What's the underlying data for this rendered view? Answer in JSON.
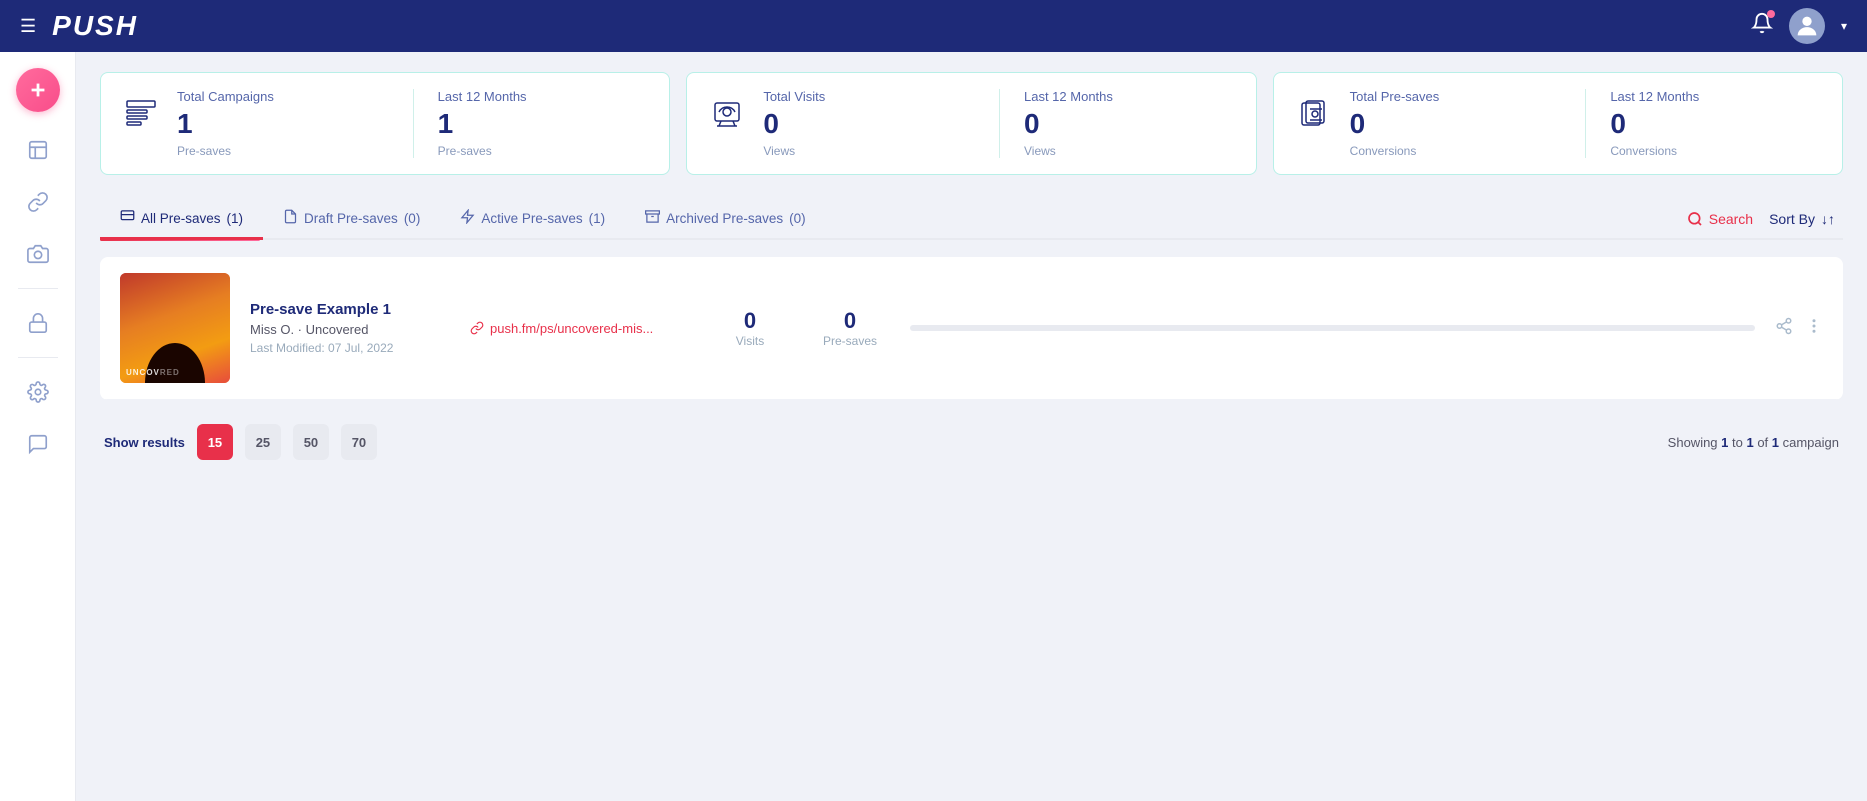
{
  "header": {
    "logo": "PUSH",
    "notification_label": "notifications",
    "chevron_label": "▾"
  },
  "sidebar": {
    "add_label": "+",
    "items": [
      {
        "id": "campaigns",
        "icon": "campaigns-icon"
      },
      {
        "id": "link",
        "icon": "link-icon"
      },
      {
        "id": "camera",
        "icon": "camera-icon"
      },
      {
        "id": "lock",
        "icon": "lock-icon"
      },
      {
        "id": "settings",
        "icon": "settings-icon"
      },
      {
        "id": "chat",
        "icon": "chat-icon"
      }
    ]
  },
  "stats": [
    {
      "id": "campaigns-stat",
      "title": "Total Campaigns",
      "value": "1",
      "sub": "Pre-saves",
      "last12_value": "1",
      "last12_sub": "Pre-saves",
      "last12_title": "Last 12 Months"
    },
    {
      "id": "visits-stat",
      "title": "Total Visits",
      "value": "0",
      "sub": "Views",
      "last12_value": "0",
      "last12_sub": "Views",
      "last12_title": "Last 12 Months"
    },
    {
      "id": "presaves-stat",
      "title": "Total Pre-saves",
      "value": "0",
      "sub": "Conversions",
      "last12_value": "0",
      "last12_sub": "Conversions",
      "last12_title": "Last 12 Months"
    }
  ],
  "tabs": [
    {
      "id": "all",
      "label": "All Pre-saves",
      "count": "(1)",
      "active": true
    },
    {
      "id": "draft",
      "label": "Draft Pre-saves",
      "count": "(0)",
      "active": false
    },
    {
      "id": "active",
      "label": "Active Pre-saves",
      "count": "(1)",
      "active": false
    },
    {
      "id": "archived",
      "label": "Archived Pre-saves",
      "count": "(0)",
      "active": false
    }
  ],
  "tabs_actions": {
    "search_label": "Search",
    "sort_label": "Sort By",
    "sort_icon": "↓↑"
  },
  "campaigns": [
    {
      "id": "campaign-1",
      "name": "Pre-save Example 1",
      "artist": "Miss O. · Uncovered",
      "modified": "Last Modified: 07 Jul, 2022",
      "link": "push.fm/ps/uncovered-mis...",
      "visits": "0",
      "visits_label": "Visits",
      "presaves": "0",
      "presaves_label": "Pre-saves",
      "progress": 0
    }
  ],
  "pagination": {
    "show_results_label": "Show results",
    "options": [
      15,
      25,
      50,
      70
    ],
    "active_option": 15,
    "info": "Showing 1 to 1 of 1 campaign"
  }
}
